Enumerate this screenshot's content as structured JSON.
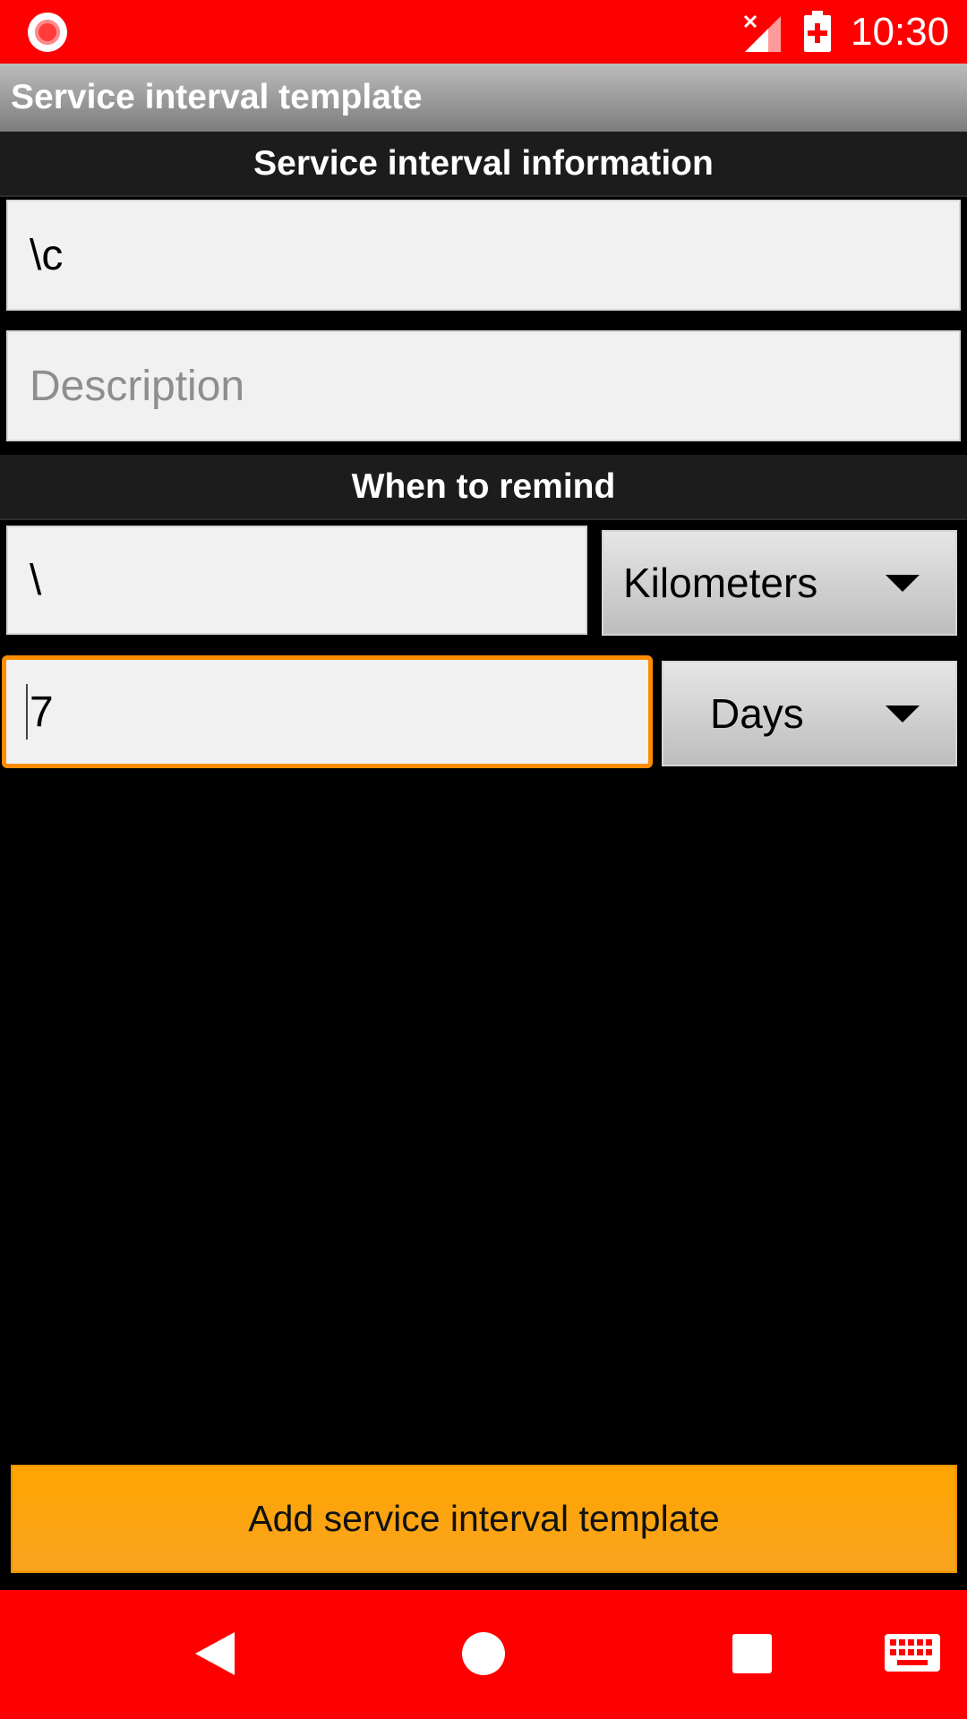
{
  "status_bar": {
    "time": "10:30",
    "icons": [
      "record-icon",
      "signal-off-icon",
      "battery-charging-icon"
    ]
  },
  "app_bar": {
    "title": "Service interval template"
  },
  "sections": {
    "info_header": "Service interval information",
    "remind_header": "When to remind"
  },
  "form": {
    "name_value": "\\c",
    "description_placeholder": "Description",
    "distance_value": "\\",
    "distance_unit": "Kilometers",
    "time_value": "7",
    "time_unit": "Days"
  },
  "actions": {
    "add_label": "Add service interval template"
  },
  "nav_bar": {
    "icons": [
      "back-icon",
      "home-icon",
      "recent-apps-icon",
      "keyboard-icon"
    ]
  },
  "colors": {
    "status_bar": "#ff0000",
    "accent": "#ffa400",
    "focus": "#ff8c00"
  }
}
